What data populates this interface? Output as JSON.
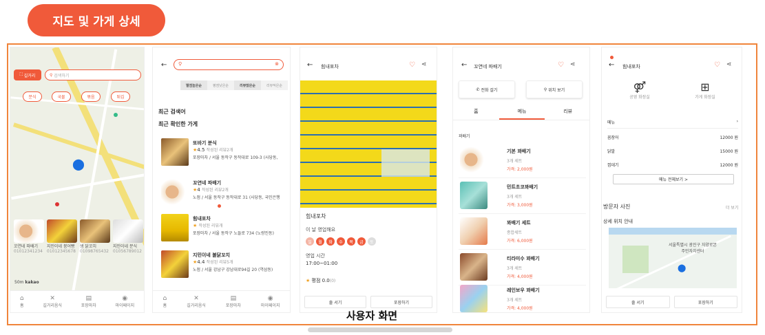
{
  "header": {
    "title": "지도 및 가게 상세"
  },
  "caption": "사용자 화면",
  "colors": {
    "accent": "#f05a3a",
    "frame": "#f0843a"
  },
  "screen1": {
    "scan_button": "길거리",
    "search_placeholder": "검색하기",
    "chips": [
      "분식",
      "국물",
      "볶음",
      "튀김"
    ],
    "cards": [
      {
        "name": "꼬연네 파배기",
        "sub": "01012341234"
      },
      {
        "name": "지민이네 붕어빵",
        "sub": "01012345678"
      },
      {
        "name": "생 닭꼬치",
        "sub": "01098765432"
      },
      {
        "name": "지민이네 분식",
        "sub": "01056789012"
      }
    ],
    "scale": "50m",
    "brand": "kakao",
    "tabs": [
      {
        "icon": "home-icon",
        "label": "홈"
      },
      {
        "icon": "utensils-icon",
        "label": "길거리음식"
      },
      {
        "icon": "shop-icon",
        "label": "포장마차"
      },
      {
        "icon": "user-icon",
        "label": "마이페이지"
      }
    ]
  },
  "screen2": {
    "filters": [
      "별점높은순",
      "평점낮은순",
      "리뷰많은순",
      "리뷰적은순"
    ],
    "recent_search": "최근 검색어",
    "recent_stores": "최근 확인한 가게",
    "items": [
      {
        "name": "또바기 분식",
        "rating": "4.5",
        "reviews": "작성된 리뷰2개",
        "addr": "포장마차 / 서울 동작구 동작대로 109-3 (사당동,"
      },
      {
        "name": "꼬연네 파배기",
        "rating": "4",
        "reviews": "작성된 리뷰2개",
        "addr": "노점 / 서울 동작구 동작대로 31 (사당동, 국민은행"
      },
      {
        "name": "힘내포차",
        "rating": "",
        "reviews": "작성된 리뷰개",
        "addr": "포장마차 / 서울 동작구 노들로 734 (노량진동)"
      },
      {
        "name": "지민이네 불닭꼬치",
        "rating": "4.4",
        "reviews": "작성된 리뷰5개",
        "addr": "노점 / 서울 강남구 강남대로94길 20 (역삼동)"
      }
    ],
    "tabs": [
      "홈",
      "길거리음식",
      "포장마차",
      "마이페이지"
    ]
  },
  "screen3": {
    "title": "힘내포차",
    "store_name": "힘내포차",
    "open_status": "이 날 영업해요",
    "days": [
      "일",
      "월",
      "화",
      "수",
      "목",
      "금",
      "토"
    ],
    "hours_label": "영업 시간",
    "hours": "17:00~01:00",
    "rating_label": "평점 0.0",
    "rating_sub": "(0)",
    "buttons": [
      "줄 서기",
      "포장하기"
    ]
  },
  "screen4": {
    "title": "꼬연네 파배기",
    "call": "전화 걸기",
    "location": "위치 보기",
    "tabs": [
      "홈",
      "메뉴",
      "리뷰"
    ],
    "section": "꽈배기",
    "menu": [
      {
        "name": "기본 꽈배기",
        "desc": "3개 세트",
        "price": "가격: 2,000원"
      },
      {
        "name": "민트초코꽈배기",
        "desc": "3개 세트",
        "price": "가격: 3,000원"
      },
      {
        "name": "꽈배기 세트",
        "desc": "종합세트",
        "price": "가격: 6,000원"
      },
      {
        "name": "티라미수 꽈배기",
        "desc": "3개 세트",
        "price": "가격: 4,000원"
      },
      {
        "name": "레인보우 꽈배기",
        "desc": "3개 세트",
        "price": "가격: 4,000원"
      }
    ]
  },
  "screen5": {
    "title": "힘내포차",
    "facilities": [
      "공영 화장실",
      "가게 화장실"
    ],
    "menu_header": "메뉴",
    "menu": [
      {
        "name": "꼼장어",
        "price": "12000 원"
      },
      {
        "name": "닭발",
        "price": "15000 원"
      },
      {
        "name": "껍데기",
        "price": "12000 원"
      }
    ],
    "menu_all": "메뉴 전체보기 >",
    "photos": "방문자 사진",
    "more": "더 보기",
    "location": "상세 위치 안내",
    "map_label": "서울특별시 광진구 자양로본 주민자치센터",
    "buttons": [
      "줄 서기",
      "포장하기"
    ]
  }
}
